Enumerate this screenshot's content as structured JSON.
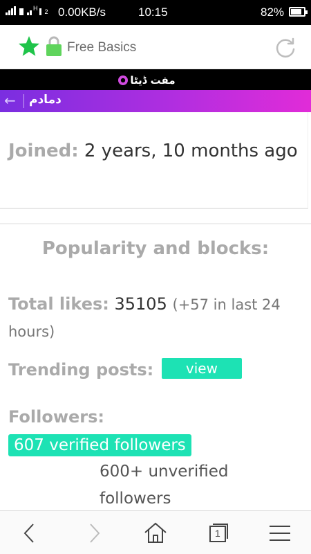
{
  "status_bar": {
    "net_small": "H",
    "net_small2": "2",
    "speed": "0.00KB/s",
    "time": "10:15",
    "battery_pct": "82%",
    "battery_level": 0.82
  },
  "browser": {
    "title": "Free Basics",
    "icons": [
      "star-icon",
      "lock-icon",
      "reload-icon"
    ],
    "colors": {
      "star": "#1fc44a",
      "lock": "#5fd45c"
    }
  },
  "banner": {
    "label": "مفت ڈیٹا"
  },
  "app_header": {
    "title": "دمادم",
    "back_icon": "arrow-left-icon",
    "gradient": [
      "#7a2ee0",
      "#e12cd8"
    ]
  },
  "profile": {
    "joined_label": "Joined:",
    "joined_value": "2 years, 10 months ago",
    "popularity_title": "Popularity and blocks:",
    "likes_label": "Total likes:",
    "likes_value": "35105",
    "likes_extra": "(+57 in last 24 hours)",
    "trending_label": "Trending posts:",
    "view_button": "view",
    "followers_label": "Followers:",
    "verified_followers": "607 verified followers",
    "unverified_followers": "600+ unverified followers",
    "accent": "#1de2b4"
  },
  "bottom_nav": {
    "icons": [
      "back-icon",
      "forward-icon",
      "home-icon",
      "tabs-icon",
      "menu-icon"
    ],
    "tab_count": "1"
  }
}
